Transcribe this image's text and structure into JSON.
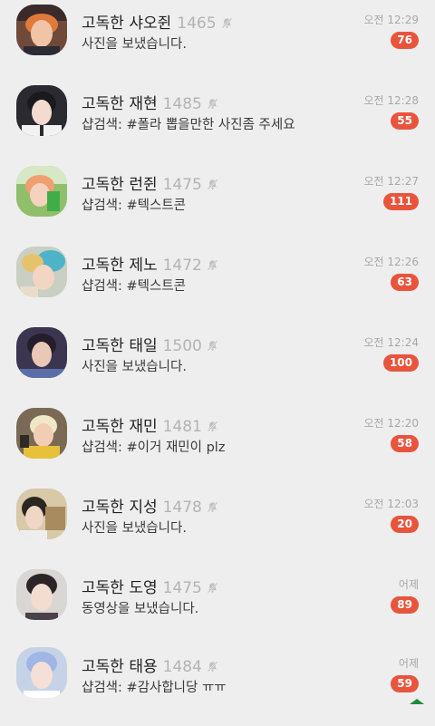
{
  "chats": [
    {
      "name": "고독한 샤오쥔",
      "member_count": "1465",
      "last_message": "사진을 보냈습니다.",
      "time": "오전 12:29",
      "unread": "76",
      "muted": true,
      "avatar": "avatar-1"
    },
    {
      "name": "고독한 재현",
      "member_count": "1485",
      "last_message": "샵검색: #폴라 뽑을만한 사진좀 주세요",
      "time": "오전 12:28",
      "unread": "55",
      "muted": true,
      "avatar": "avatar-2"
    },
    {
      "name": "고독한 런쥔",
      "member_count": "1475",
      "last_message": "샵검색: #텍스트콘",
      "time": "오전 12:27",
      "unread": "111",
      "muted": true,
      "avatar": "avatar-3"
    },
    {
      "name": "고독한 제노",
      "member_count": "1472",
      "last_message": "샵검색: #텍스트콘",
      "time": "오전 12:26",
      "unread": "63",
      "muted": true,
      "avatar": "avatar-4"
    },
    {
      "name": "고독한 태일",
      "member_count": "1500",
      "last_message": "사진을 보냈습니다.",
      "time": "오전 12:24",
      "unread": "100",
      "muted": true,
      "avatar": "avatar-5"
    },
    {
      "name": "고독한 재민",
      "member_count": "1481",
      "last_message": "샵검색: #이거 재민이 plz",
      "time": "오전 12:20",
      "unread": "58",
      "muted": true,
      "avatar": "avatar-6"
    },
    {
      "name": "고독한 지성",
      "member_count": "1478",
      "last_message": "사진을 보냈습니다.",
      "time": "오전 12:03",
      "unread": "20",
      "muted": true,
      "avatar": "avatar-7"
    },
    {
      "name": "고독한 도영",
      "member_count": "1475",
      "last_message": "동영상을 보냈습니다.",
      "time": "어제",
      "unread": "89",
      "muted": true,
      "avatar": "avatar-8"
    },
    {
      "name": "고독한 태용",
      "member_count": "1484",
      "last_message": "샵검색: #감사합니당 ㅠㅠ",
      "time": "어제",
      "unread": "59",
      "muted": true,
      "avatar": "avatar-9"
    }
  ],
  "colors": {
    "background": "#eeeeee",
    "badge": "#e9543c",
    "member_count": "#b3b3b3",
    "time": "#a8a8a8"
  }
}
